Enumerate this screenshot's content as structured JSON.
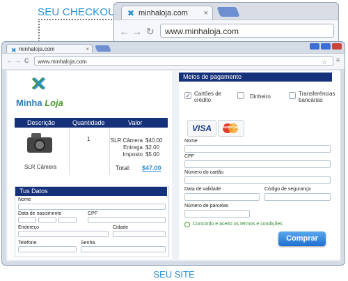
{
  "callout": {
    "checkout_title": "SEU CHECKOUT",
    "site_label": "SEU SITE"
  },
  "zoom_browser": {
    "tab_title": "minhaloja.com",
    "tab_close": "×",
    "url": "www.minhaloja.com",
    "back": "←",
    "forward": "→",
    "reload": "↻"
  },
  "browser": {
    "tab_title": "minhaloja.com",
    "tab_close": "×",
    "url": "www.minhaloja.com",
    "back": "←",
    "forward": "→",
    "reload": "C",
    "star": "☆",
    "menu": "≡"
  },
  "store": {
    "logo_icon": "x-logo-icon",
    "name_part1": "Minha",
    "name_part2": "Loja"
  },
  "order": {
    "headers": {
      "desc": "Descrição",
      "qty": "Quantidade",
      "value": "Valor"
    },
    "product_name": "SLR Câmera",
    "quantity": "1",
    "lines": [
      {
        "label": "SLR Câmera",
        "value": "$40.00"
      },
      {
        "label": "Entrega",
        "value": "$2.00"
      },
      {
        "label": "Imposto",
        "value": "$5.00"
      }
    ],
    "total_label": "Total:",
    "total_value": "$47.00"
  },
  "dados": {
    "title": "Tus Datos",
    "nome": "Nome",
    "nascimento": "Data de nascimento",
    "cpf": "CPF",
    "endereco": "Endereço",
    "cidade": "Cidade",
    "telefone": "Telefone",
    "senha": "Senha"
  },
  "payment": {
    "title": "Meios de pagamento",
    "options": [
      {
        "label": "Cartões de crédito",
        "checked": true
      },
      {
        "label": "Dinheiro",
        "checked": false
      },
      {
        "label": "Transferências bancárias",
        "checked": false
      }
    ],
    "check_mark": "✓",
    "cards": {
      "visa": "VISA",
      "mastercard": "MasterCard"
    },
    "fields": {
      "nome": "Nome",
      "cpf": "CPF",
      "numero": "Número do cartão",
      "validade": "Data de validade",
      "codigo": "Código de segurança",
      "parcelas": "Número de parcelas"
    },
    "terms": "Concordo e aceito os termos e condições",
    "submit": "Comprar"
  }
}
